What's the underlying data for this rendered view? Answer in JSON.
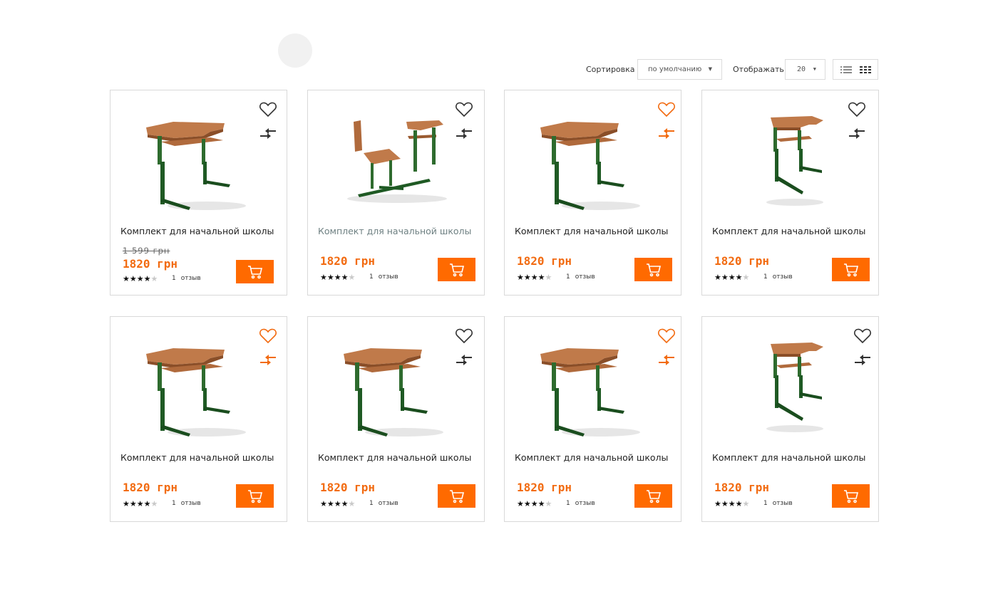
{
  "toolbar": {
    "sort_label": "Сортировка",
    "sort_value": "по умолчанию",
    "show_label": "Отображать",
    "show_value": "20"
  },
  "icons": {
    "wishlist": "heart-icon",
    "compare": "compare-arrows-icon",
    "cart": "cart-icon",
    "list_view": "list-view-icon",
    "grid_view": "grid-view-icon"
  },
  "colors": {
    "accent": "#ff6a00",
    "price": "#f26b11",
    "icon_default": "#333333",
    "icon_active": "#f26b11"
  },
  "products": [
    {
      "title": "Комплект для начальной школы",
      "old_price": "1 599 грн",
      "price": "1820 грн",
      "rating": 4,
      "reviews_count": "1",
      "reviews_label": "отзыв",
      "wishlist_active": false,
      "compare_active": false
    },
    {
      "title": "Комплект для начальной школы",
      "price": "1820 грн",
      "rating": 4,
      "reviews_count": "1",
      "reviews_label": "отзыв",
      "wishlist_active": false,
      "compare_active": false
    },
    {
      "title": "Комплект для начальной школы",
      "price": "1820 грн",
      "rating": 4,
      "reviews_count": "1",
      "reviews_label": "отзыв",
      "wishlist_active": true,
      "compare_active": true
    },
    {
      "title": "Комплект для начальной школы",
      "price": "1820 грн",
      "rating": 4,
      "reviews_count": "1",
      "reviews_label": "отзыв",
      "wishlist_active": false,
      "compare_active": false
    },
    {
      "title": "Комплект для начальной школы",
      "price": "1820 грн",
      "rating": 4,
      "reviews_count": "1",
      "reviews_label": "отзыв",
      "wishlist_active": true,
      "compare_active": true
    },
    {
      "title": "Комплект для начальной школы",
      "price": "1820 грн",
      "rating": 4,
      "reviews_count": "1",
      "reviews_label": "отзыв",
      "wishlist_active": false,
      "compare_active": false
    },
    {
      "title": "Комплект для начальной школы",
      "price": "1820 грн",
      "rating": 4,
      "reviews_count": "1",
      "reviews_label": "отзыв",
      "wishlist_active": true,
      "compare_active": true
    },
    {
      "title": "Комплект для начальной школы",
      "price": "1820 грн",
      "rating": 4,
      "reviews_count": "1",
      "reviews_label": "отзыв",
      "wishlist_active": false,
      "compare_active": false
    }
  ]
}
